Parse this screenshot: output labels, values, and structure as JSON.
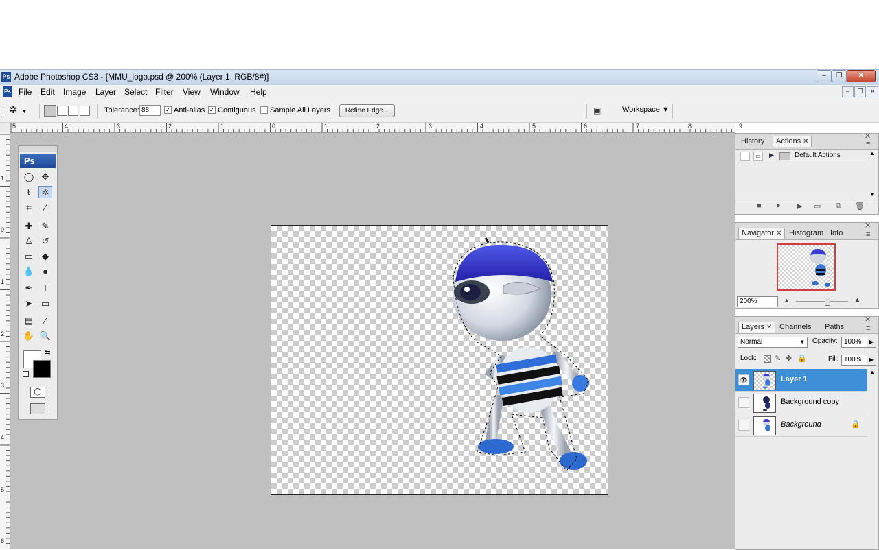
{
  "window": {
    "title": "Adobe Photoshop CS3 - [MMU_logo.psd @ 200% (Layer 1, RGB/8#)]",
    "app_badge": "Ps",
    "controls": [
      "–",
      "❐",
      "✕"
    ]
  },
  "menu": {
    "items": [
      "File",
      "Edit",
      "Image",
      "Layer",
      "Select",
      "Filter",
      "View",
      "Window",
      "Help"
    ],
    "doc_controls": [
      "–",
      "❐",
      "✕"
    ]
  },
  "options": {
    "tolerance_label": "Tolerance:",
    "tolerance_value": "88",
    "anti_alias_label": "Anti-alias",
    "anti_alias_checked": true,
    "contiguous_label": "Contiguous",
    "contiguous_checked": true,
    "sample_all_label": "Sample All Layers",
    "sample_all_checked": false,
    "refine_edge_label": "Refine Edge...",
    "workspace_label": "Workspace ▼"
  },
  "rulers": {
    "top_labels": [
      "5",
      "4",
      "3",
      "2",
      "1",
      "0",
      "1",
      "2",
      "3",
      "4",
      "5",
      "6",
      "7",
      "8",
      "9",
      "10",
      "11"
    ],
    "left_labels": [
      "1",
      "0",
      "1",
      "2",
      "3",
      "4",
      "5",
      "6"
    ]
  },
  "toolbox": {
    "header": "Ps",
    "tools": [
      {
        "name": "elliptical-marquee-icon",
        "glyph": "◯"
      },
      {
        "name": "move-icon",
        "glyph": "✥"
      },
      {
        "name": "lasso-icon",
        "glyph": "ℓ"
      },
      {
        "name": "magic-wand-icon",
        "glyph": "✲",
        "active": true
      },
      {
        "name": "crop-icon",
        "glyph": "⌗"
      },
      {
        "name": "eyedropper-icon",
        "glyph": "⁄"
      },
      {
        "name": "healing-brush-icon",
        "glyph": "✚"
      },
      {
        "name": "brush-icon",
        "glyph": "✎"
      },
      {
        "name": "clone-stamp-icon",
        "glyph": "♙"
      },
      {
        "name": "history-brush-icon",
        "glyph": "↺"
      },
      {
        "name": "eraser-icon",
        "glyph": "▭"
      },
      {
        "name": "paint-bucket-icon",
        "glyph": "◆"
      },
      {
        "name": "blur-icon",
        "glyph": "💧"
      },
      {
        "name": "dodge-icon",
        "glyph": "●"
      },
      {
        "name": "pen-icon",
        "glyph": "✒"
      },
      {
        "name": "type-icon",
        "glyph": "T"
      },
      {
        "name": "path-selection-icon",
        "glyph": "➤"
      },
      {
        "name": "rectangle-shape-icon",
        "glyph": "▭"
      },
      {
        "name": "notes-icon",
        "glyph": "▤"
      },
      {
        "name": "color-sampler-icon",
        "glyph": "⁄"
      },
      {
        "name": "hand-icon",
        "glyph": "✋"
      },
      {
        "name": "zoom-icon",
        "glyph": "🔍"
      }
    ]
  },
  "history_panel": {
    "tabs": [
      "History",
      "Actions"
    ],
    "active_tab": "Actions",
    "action_set": "Default Actions"
  },
  "navigator_panel": {
    "tabs": [
      "Navigator",
      "Histogram",
      "Info"
    ],
    "active_tab": "Navigator",
    "zoom": "200%"
  },
  "layers_panel": {
    "tabs": [
      "Layers",
      "Channels",
      "Paths"
    ],
    "active_tab": "Layers",
    "blend_mode": "Normal",
    "opacity_label": "Opacity:",
    "opacity": "100%",
    "lock_label": "Lock:",
    "fill_label": "Fill:",
    "fill": "100%",
    "layers": [
      {
        "name": "Layer 1",
        "selected": true,
        "visible": true
      },
      {
        "name": "Background copy",
        "selected": false,
        "visible": false
      },
      {
        "name": "Background",
        "selected": false,
        "visible": false,
        "locked": true
      }
    ]
  }
}
